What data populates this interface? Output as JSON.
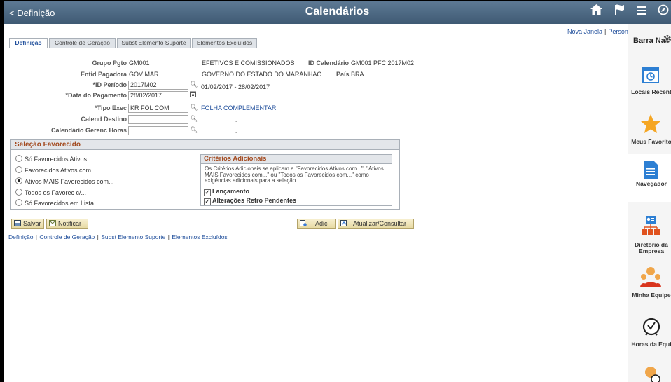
{
  "header": {
    "back_label": "< Definição",
    "title": "Calendários",
    "icons": [
      "home-icon",
      "flag-icon",
      "menu-icon",
      "compass-icon"
    ]
  },
  "toplinks": {
    "new_window": "Nova Janela",
    "personalize": "Persona"
  },
  "tabs": [
    {
      "label": "Definição"
    },
    {
      "label": "Controle de Geração"
    },
    {
      "label": "Subst Elemento Suporte"
    },
    {
      "label": "Elementos Excluídos"
    }
  ],
  "form": {
    "grupo_pgto": {
      "label": "Grupo Pgto",
      "value": "GM001",
      "desc": "EFETIVOS E COMISSIONADOS"
    },
    "id_calendario": {
      "label": "ID Calendário",
      "value": "GM001 PFC 2017M02"
    },
    "entid_pagadora": {
      "label": "Entid Pagadora",
      "value": "GOV MAR",
      "desc": "GOVERNO DO ESTADO DO MARANHÃO"
    },
    "pais": {
      "label": "País",
      "value": "BRA"
    },
    "id_periodo": {
      "label": "*ID Período",
      "value": "2017M02",
      "range": "01/02/2017  -  28/02/2017"
    },
    "data_pagamento": {
      "label": "*Data do Pagamento",
      "value": "28/02/2017"
    },
    "tipo_exec": {
      "label": "*Tipo Exec",
      "value": "KR FOL COM",
      "desc": "FOLHA COMPLEMENTAR"
    },
    "calend_destino": {
      "label": "Calend Destino",
      "value": "",
      "desc": "-"
    },
    "calendario_gerenc": {
      "label": "Calendário Gerenc Horas",
      "value": "",
      "desc": "-"
    }
  },
  "selecao": {
    "title": "Seleção Favorecido",
    "options": [
      {
        "label": "Só Favorecidos Ativos",
        "selected": false
      },
      {
        "label": "Favorecidos Ativos com...",
        "selected": false
      },
      {
        "label": "Ativos MAIS Favorecidos com...",
        "selected": true
      },
      {
        "label": "Todos os Favorec c/...",
        "selected": false
      },
      {
        "label": "Só Favorecidos em Lista",
        "selected": false
      }
    ]
  },
  "criterios": {
    "title": "Critérios Adicionais",
    "text": "Os Critérios Adicionais se aplicam a \"Favorecidos Ativos com...\", \"Ativos MAIS Favorecidos com...\" ou \"Todos os Favorecidos com...\" como exigências adicionais para a seleção.",
    "checks": [
      {
        "label": "Lançamento",
        "checked": true
      },
      {
        "label": "Alterações Retro Pendentes",
        "checked": true
      }
    ]
  },
  "buttons": {
    "salvar": "Salvar",
    "notificar": "Notificar",
    "adic": "Adic",
    "atualizar": "Atualizar/Consultar"
  },
  "bottom_links": [
    "Definição",
    "Controle de Geração",
    "Subst Elemento Suporte",
    "Elementos Excluídos"
  ],
  "nav": {
    "title": "Barra Na",
    "items": [
      {
        "label": "Locais Recent",
        "icon": "calendar-clock-icon"
      },
      {
        "label": "Meus Favorito",
        "icon": "star-icon"
      },
      {
        "label": "Navegador",
        "icon": "document-icon"
      },
      {
        "label": "Diretório da Empresa",
        "icon": "org-chart-icon"
      },
      {
        "label": "Minha Equipe",
        "icon": "team-icon"
      },
      {
        "label": "Horas da Equi",
        "icon": "clock-icon"
      }
    ]
  },
  "colors": {
    "header": "#4a6682",
    "link": "#1f4e9b",
    "section_title": "#a34a1f",
    "star": "#f5a623",
    "nav_blue": "#2d7fd3"
  }
}
